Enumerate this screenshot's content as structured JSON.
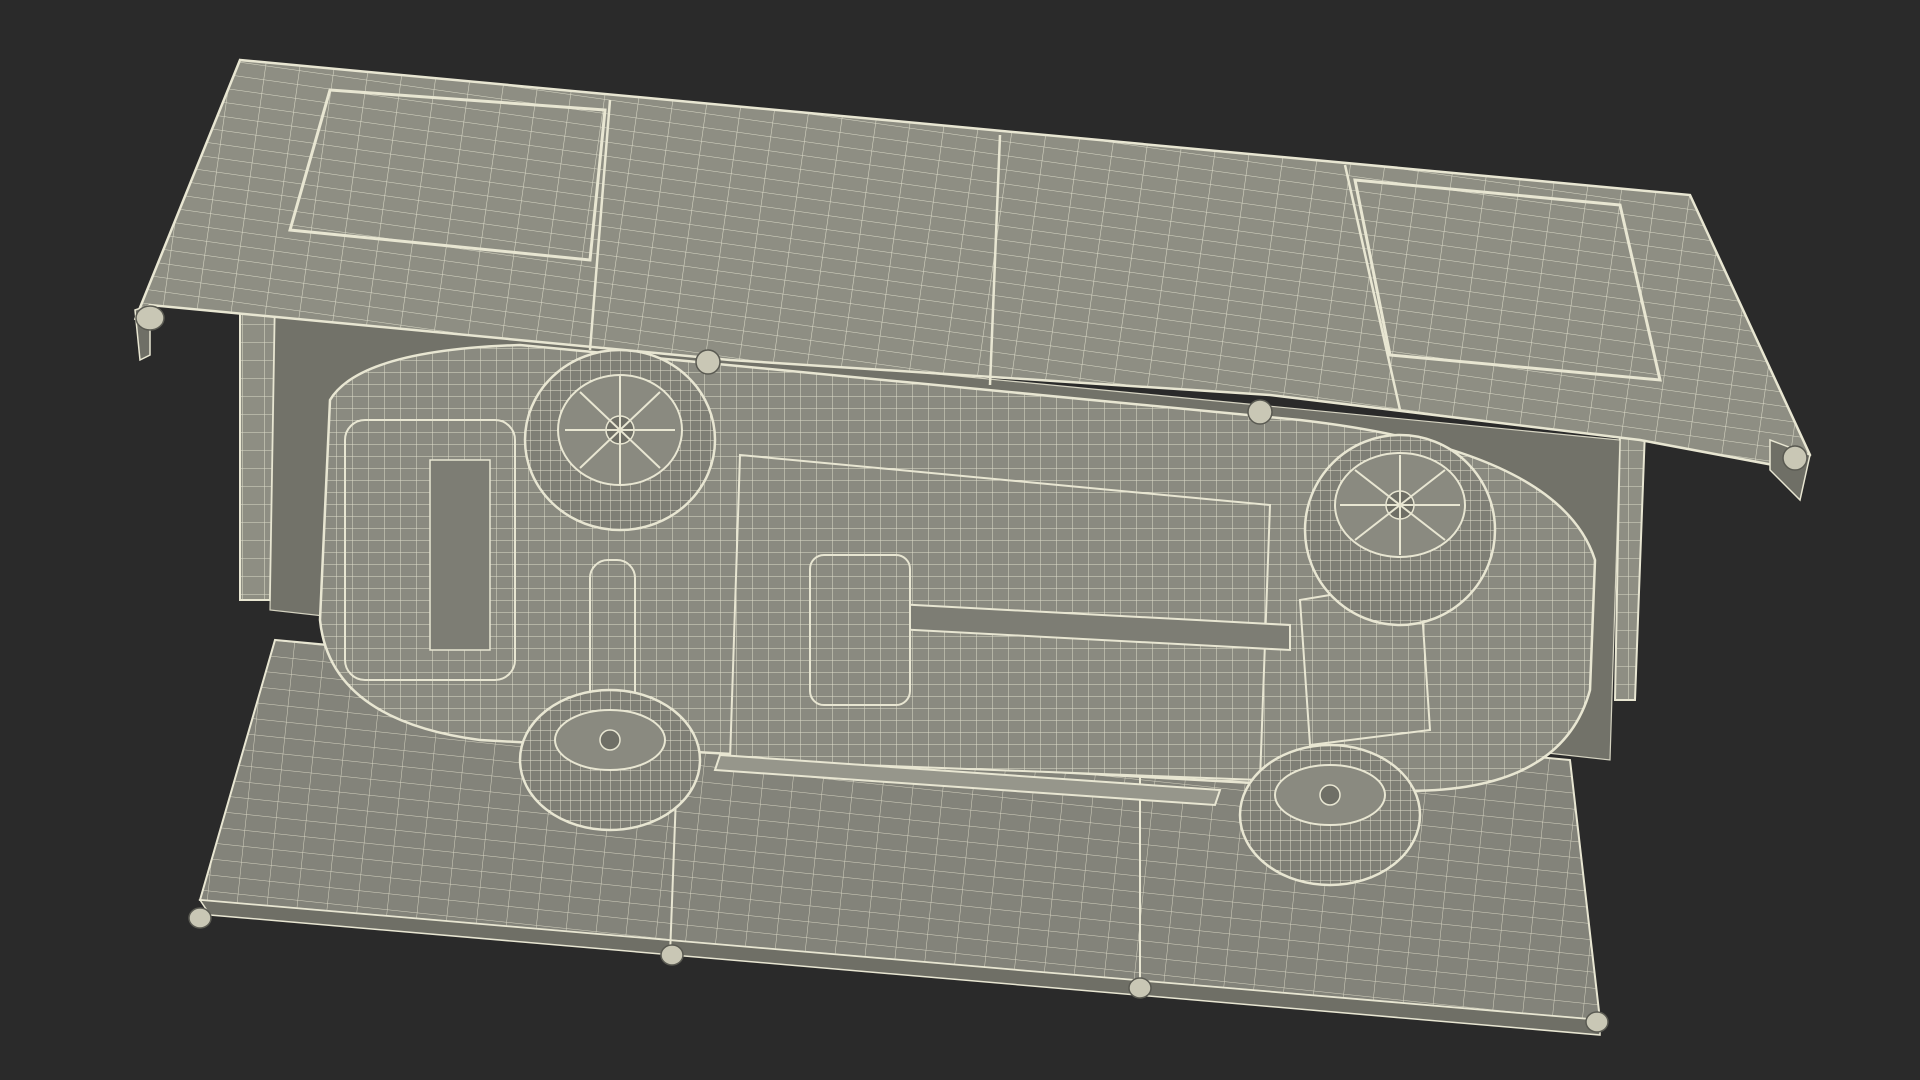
{
  "scene": {
    "background_color": "#2a2a2a",
    "surface_color": "#8e8e83",
    "surface_shadow_color": "#6f6f66",
    "wire_color": "#e8e6d2",
    "wire_shadow_color": "#5a5a52",
    "subject": "carport-with-car-underside-wireframe",
    "render_style": "wireframe-over-gray-shading"
  }
}
